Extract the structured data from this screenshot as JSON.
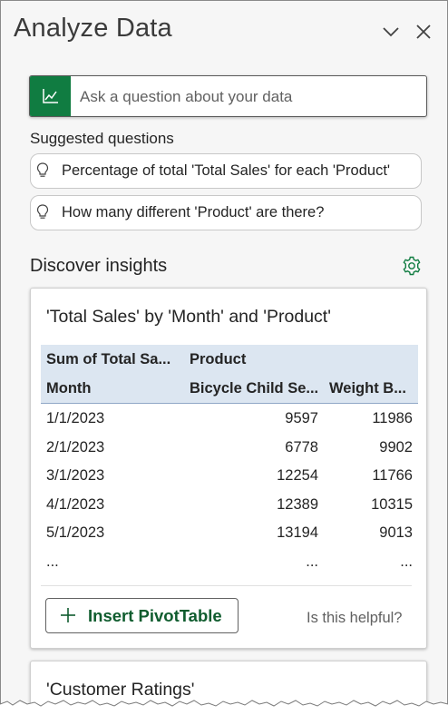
{
  "header": {
    "title": "Analyze Data"
  },
  "ask": {
    "placeholder": "Ask a question about your data"
  },
  "suggested": {
    "label": "Suggested questions",
    "items": [
      "Percentage of total 'Total Sales' for each 'Product'",
      "How many different 'Product' are there?"
    ]
  },
  "discover": {
    "label": "Discover insights"
  },
  "insight1": {
    "title": "'Total Sales' by 'Month' and 'Product'",
    "table": {
      "header_row1": {
        "c1": "Sum of Total Sa...",
        "c2": "Product"
      },
      "header_row2": {
        "c1": "Month",
        "c2": "Bicycle Child Se...",
        "c3": "Weight B..."
      },
      "rows": [
        {
          "month": "1/1/2023",
          "bike": "9597",
          "weight": "11986"
        },
        {
          "month": "2/1/2023",
          "bike": "6778",
          "weight": "9902"
        },
        {
          "month": "3/1/2023",
          "bike": "12254",
          "weight": "11766"
        },
        {
          "month": "4/1/2023",
          "bike": "12389",
          "weight": "10315"
        },
        {
          "month": "5/1/2023",
          "bike": "13194",
          "weight": "9013"
        },
        {
          "month": "...",
          "bike": "...",
          "weight": "..."
        }
      ]
    },
    "insert_label": "Insert PivotTable",
    "helpful_label": "Is this helpful?"
  },
  "insight2": {
    "title": "'Customer Ratings'"
  },
  "colors": {
    "accent": "#107c41",
    "header_fill": "#dce6f1"
  },
  "icons": {
    "collapse": "chevron-down-icon",
    "close": "close-icon",
    "ask": "chart-line-icon",
    "suggestion": "lightbulb-icon",
    "settings": "gear-icon",
    "insert": "plus-icon"
  }
}
